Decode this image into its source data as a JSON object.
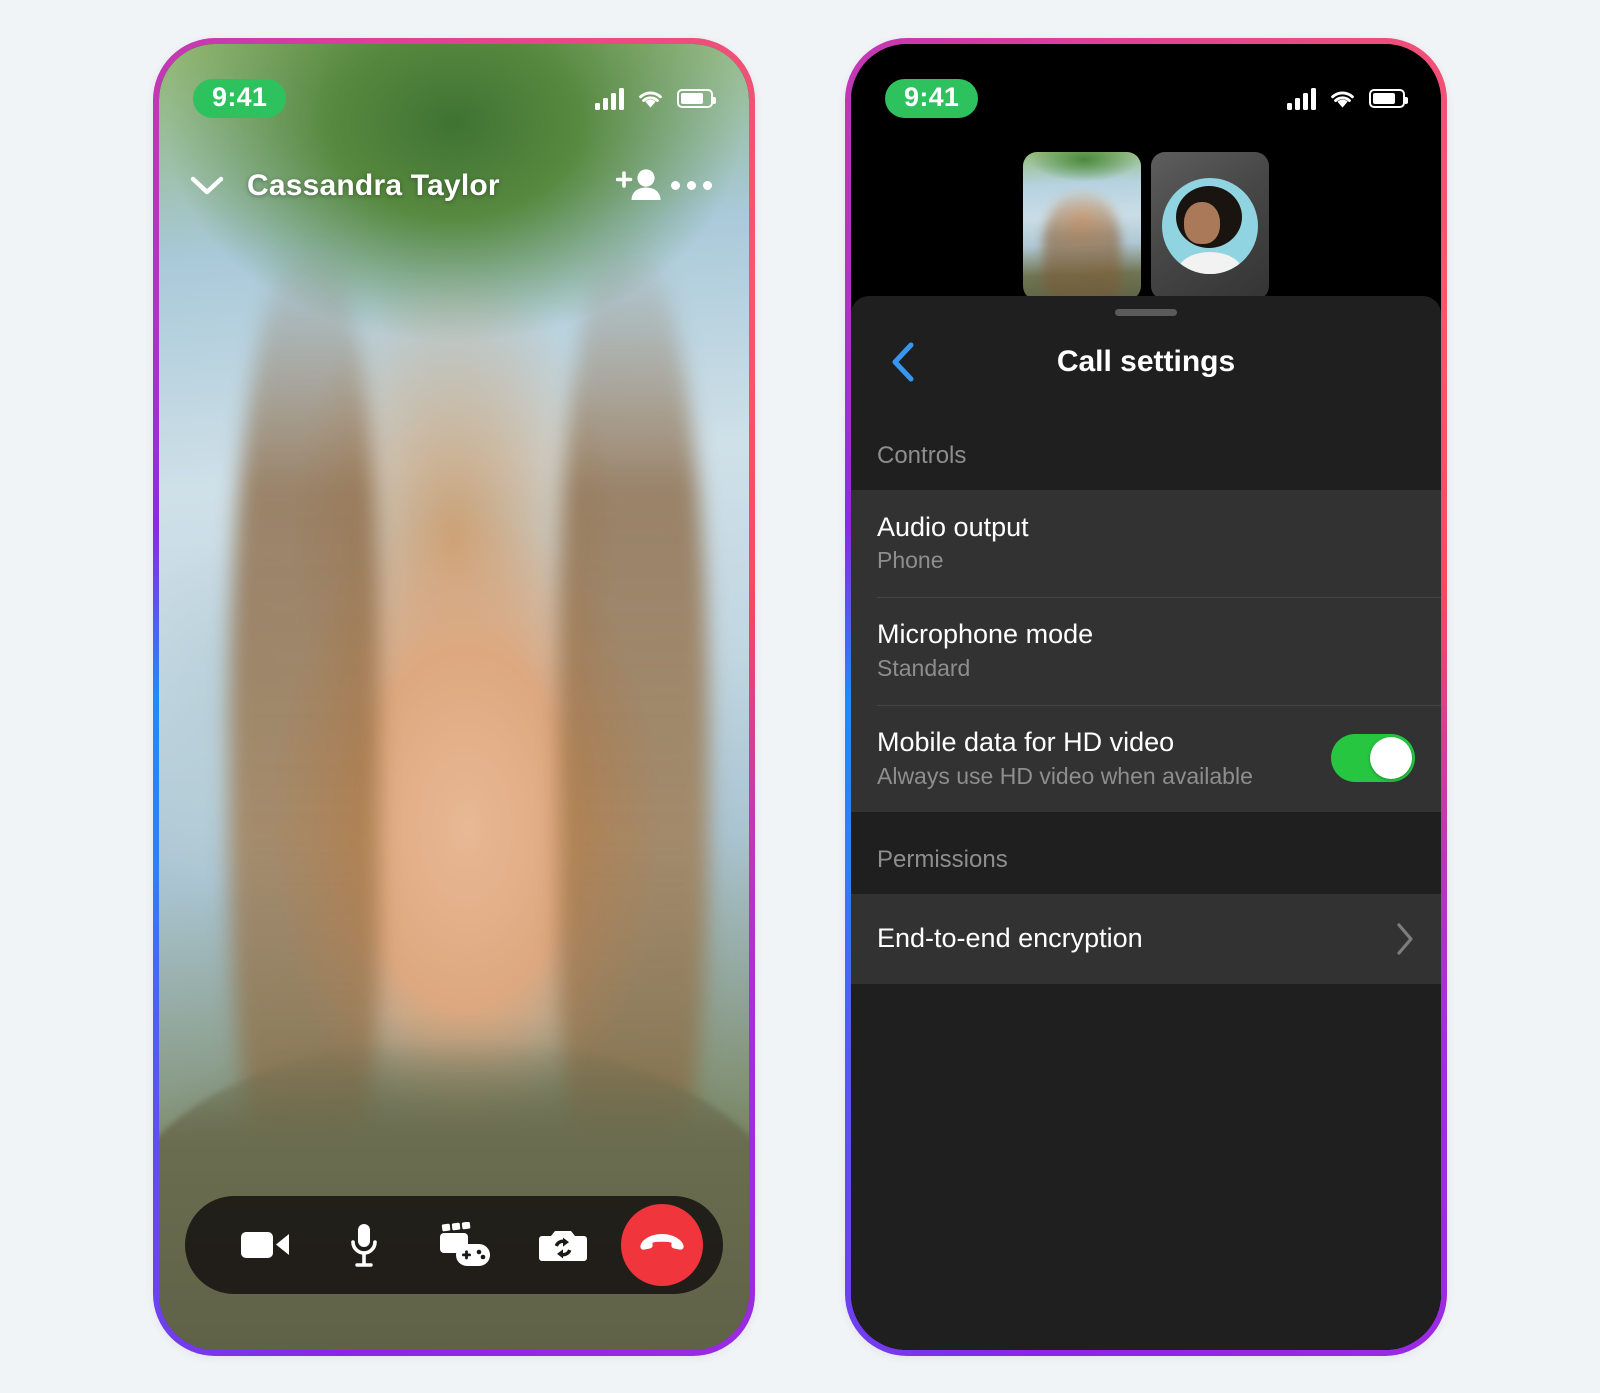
{
  "page": {
    "background_color": "#f0f4f7",
    "frame_gradient": [
      "#8a2be2",
      "#f7566b",
      "#2f7ff5"
    ]
  },
  "left_phone": {
    "status_bar": {
      "time": "9:41",
      "time_pill_color": "#2ec25e",
      "signal_icon": "cellular-bars-icon",
      "wifi_icon": "wifi-icon",
      "battery_icon": "battery-icon"
    },
    "call_header": {
      "minimize_icon": "chevron-down-icon",
      "contact_name": "Cassandra Taylor",
      "add_person_icon": "add-person-icon",
      "more_icon": "more-options-icon"
    },
    "controls": [
      {
        "name": "video-camera-button",
        "icon": "video-camera-icon",
        "label": "Video"
      },
      {
        "name": "microphone-button",
        "icon": "microphone-icon",
        "label": "Microphone"
      },
      {
        "name": "effects-games-button",
        "icon": "effects-games-icon",
        "label": "Effects and games"
      },
      {
        "name": "flip-camera-button",
        "icon": "flip-camera-icon",
        "label": "Flip camera"
      }
    ],
    "end_call": {
      "icon": "end-call-icon",
      "label": "End call",
      "color": "#f0353d"
    }
  },
  "right_phone": {
    "status_bar": {
      "time": "9:41",
      "time_pill_color": "#2ec25e",
      "signal_icon": "cellular-bars-icon",
      "wifi_icon": "wifi-icon",
      "battery_icon": "battery-icon"
    },
    "tiles": [
      {
        "name": "participant-video-tile",
        "type": "video"
      },
      {
        "name": "participant-avatar-tile",
        "type": "avatar",
        "avatar_bg": "#8fd4e0"
      }
    ],
    "sheet": {
      "grabber": "drag-handle",
      "back_icon": "chevron-left-icon",
      "back_color": "#3797f0",
      "title": "Call settings",
      "sections": [
        {
          "label": "Controls",
          "rows": [
            {
              "title": "Audio output",
              "subtitle": "Phone",
              "control": "none"
            },
            {
              "title": "Microphone mode",
              "subtitle": "Standard",
              "control": "none"
            },
            {
              "title": "Mobile data for HD video",
              "subtitle": "Always use HD video when available",
              "control": "toggle",
              "toggle_on": true,
              "toggle_color": "#26c640"
            }
          ]
        },
        {
          "label": "Permissions",
          "rows": [
            {
              "title": "End-to-end encryption",
              "subtitle": "",
              "control": "chevron"
            }
          ]
        }
      ]
    }
  }
}
